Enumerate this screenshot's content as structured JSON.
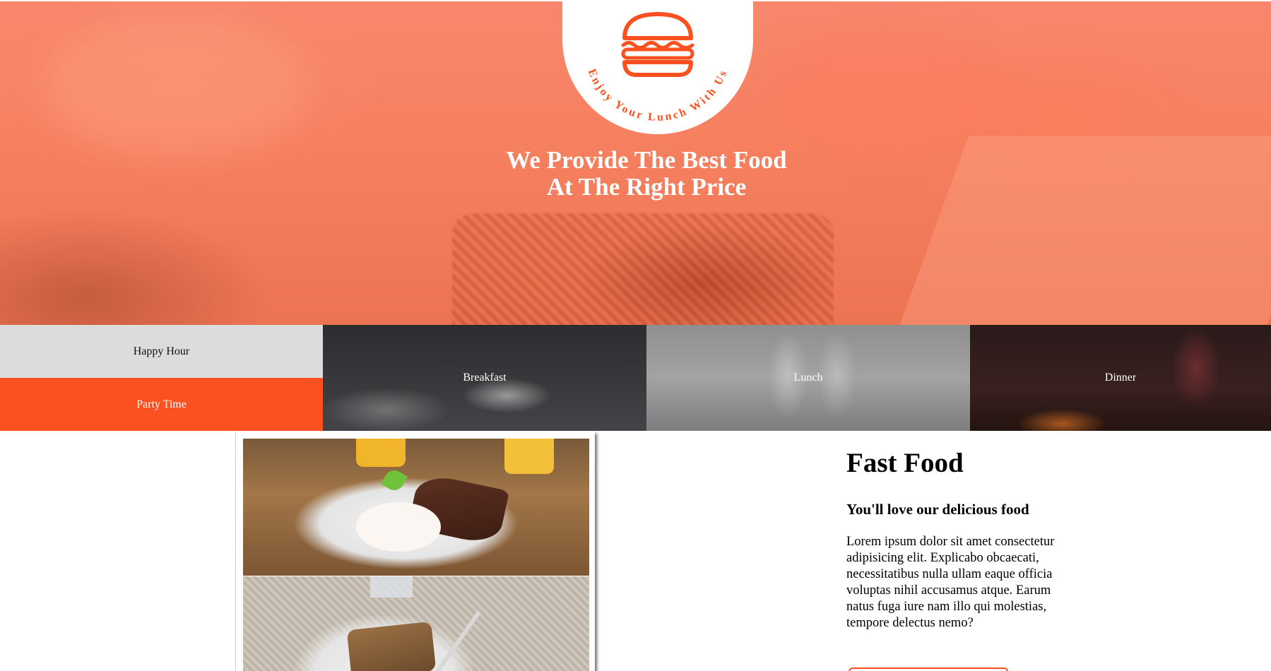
{
  "brand": {
    "logo_tagline": "Enjoy Your Lunch With Us",
    "accent_color": "#fb5121"
  },
  "hero": {
    "title_line1": "We Provide The Best Food",
    "title_line2_prefix": "At The ",
    "title_line2_bold": "Right Price"
  },
  "categories": {
    "happy_hour": "Happy Hour",
    "party_time": "Party Time",
    "breakfast": "Breakfast",
    "lunch": "Lunch",
    "dinner": "Dinner"
  },
  "feature": {
    "title": "Fast Food",
    "subtitle": "You'll love our delicious food",
    "body": "Lorem ipsum dolor sit amet consectetur adipisicing elit. Explicabo obcaecati, necessitatibus nulla ullam eaque officia voluptas nihil accusamus atque. Earum natus fuga iure nam illo qui molestias, tempore delectus nemo?"
  }
}
